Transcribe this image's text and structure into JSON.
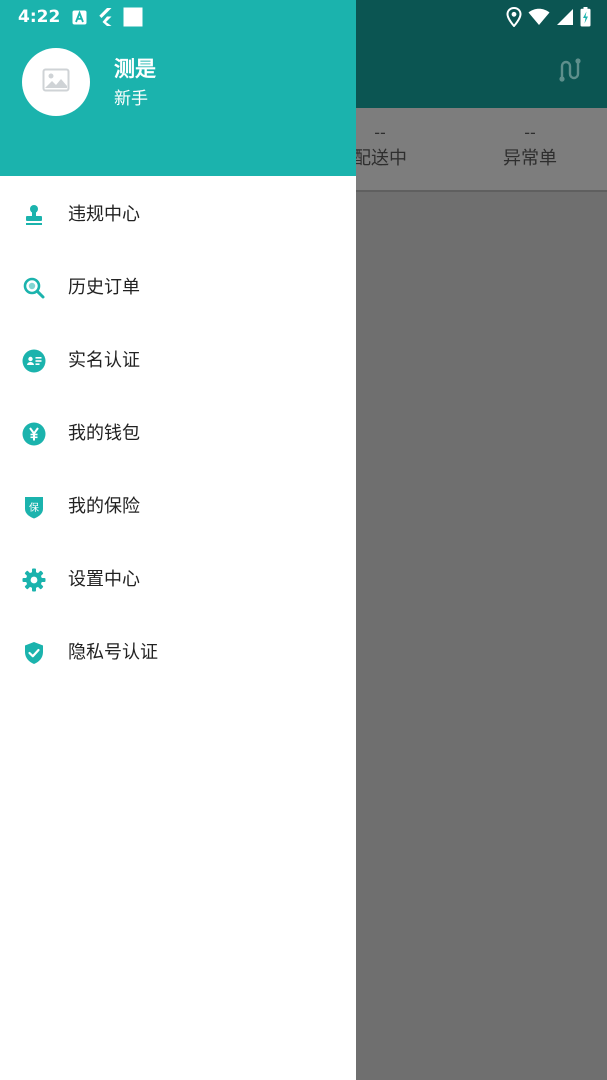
{
  "status_bar": {
    "time": "4:22",
    "left_icons": [
      "app-a-icon",
      "flutter-icon",
      "square-icon"
    ],
    "right_icons": [
      "location-icon",
      "wifi-icon",
      "signal-icon",
      "battery-icon"
    ]
  },
  "colors": {
    "drawer_header": "#1bb3ad",
    "accent_icon": "#1bb3ad",
    "app_topbar_dimmed": "#0b5552",
    "scrim": "#6f6f6f"
  },
  "background_app": {
    "topbar_icon": "route-icon",
    "stats": [
      {
        "value": "--",
        "label": "配送中"
      },
      {
        "value": "--",
        "label": "异常单"
      }
    ]
  },
  "drawer": {
    "user": {
      "avatar_icon": "image-placeholder-icon",
      "name": "测是",
      "level": "新手"
    },
    "menu": [
      {
        "icon": "stamp-icon",
        "label": "违规中心"
      },
      {
        "icon": "search-icon",
        "label": "历史订单"
      },
      {
        "icon": "id-card-icon",
        "label": "实名认证"
      },
      {
        "icon": "yen-icon",
        "label": "我的钱包"
      },
      {
        "icon": "insurance-shield-icon",
        "label": "我的保险",
        "badge": "保"
      },
      {
        "icon": "gear-icon",
        "label": "设置中心"
      },
      {
        "icon": "shield-check-icon",
        "label": "隐私号认证"
      }
    ]
  }
}
